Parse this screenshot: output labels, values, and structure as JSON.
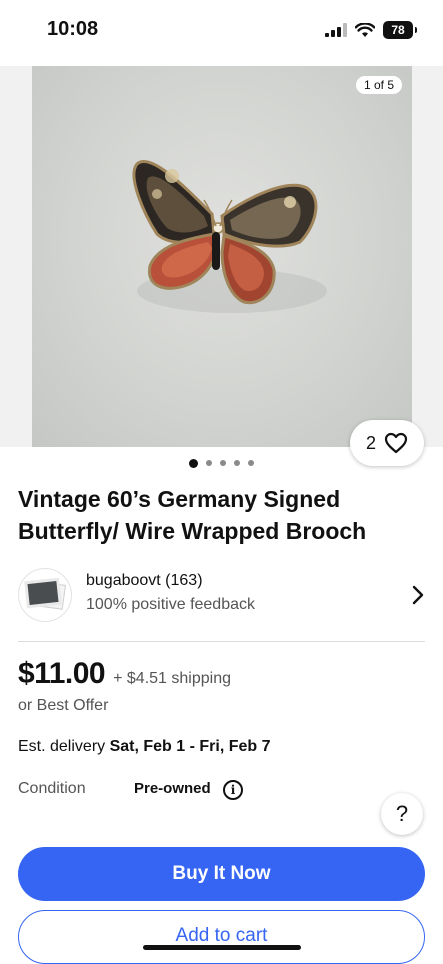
{
  "status_bar": {
    "time": "10:08",
    "battery": "78"
  },
  "gallery": {
    "counter": "1 of 5",
    "save_count": "2"
  },
  "listing": {
    "title": "Vintage 60’s Germany Signed Butterfly/ Wire Wrapped Brooch"
  },
  "seller": {
    "name": "bugaboovt (163)",
    "feedback": "100% positive feedback"
  },
  "price": {
    "amount": "$11.00",
    "shipping": "+ $4.51 shipping",
    "offer": "or Best Offer"
  },
  "delivery": {
    "label": "Est. delivery",
    "dates": "Sat, Feb 1 - Fri, Feb 7"
  },
  "condition": {
    "label": "Condition",
    "value": "Pre-owned"
  },
  "help": {
    "symbol": "?"
  },
  "actions": {
    "buy_now": "Buy It Now",
    "add_to_cart": "Add to cart"
  },
  "colors": {
    "accent": "#3665f3"
  }
}
